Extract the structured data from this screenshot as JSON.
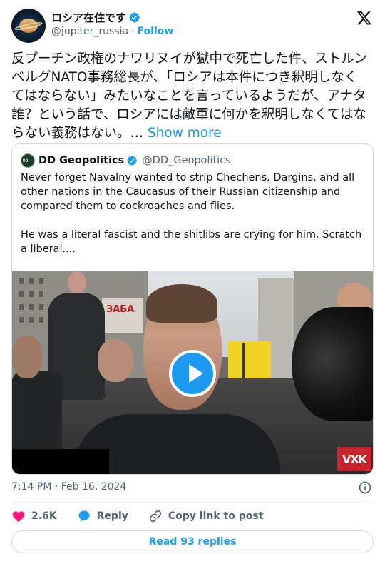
{
  "author": {
    "display_name": "ロシア在住です",
    "handle": "@jupiter_russia",
    "follow_label": "Follow",
    "separator": "·"
  },
  "tweet": {
    "text": "反プーチン政権のナワリヌイが獄中で死亡した件、ストルンベルグNATO事務総長が、「ロシアは本件につき釈明しなくてはならない」みたいなことを言っているようだが、アナタ誰？という話で、ロシアには敵軍に何かを釈明しなくてはならない義務はない。…",
    "show_more_label": "Show more"
  },
  "quote": {
    "display_name": "DD Geopolitics",
    "handle": "@DD_Geopolitics",
    "paragraphs": [
      "Never forget Navalny wanted to strip Chechens, Dargins, and all other nations in the Caucasus of their Russian citizenship and compared them to cockroaches and flies.",
      "He was a literal fascist and the shitlibs are crying for him. Scratch a liberal...."
    ],
    "video": {
      "sign_text": "ЗАБА",
      "watermark": "VXK"
    }
  },
  "meta": {
    "timestamp": "7:14 PM · Feb 16, 2024"
  },
  "actions": {
    "likes": "2.6K",
    "reply_label": "Reply",
    "copy_label": "Copy link to post",
    "read_replies_label": "Read 93 replies"
  },
  "colors": {
    "accent": "#1d9bf0",
    "like": "#f91880",
    "text": "#0f1419",
    "muted": "#536471",
    "border": "#cfd9de"
  },
  "icons": {
    "verified": "verified-badge-icon",
    "x_logo": "x-logo-icon",
    "play": "play-icon",
    "info": "info-icon",
    "heart": "heart-icon",
    "reply": "reply-bubble-icon",
    "link": "link-icon"
  }
}
